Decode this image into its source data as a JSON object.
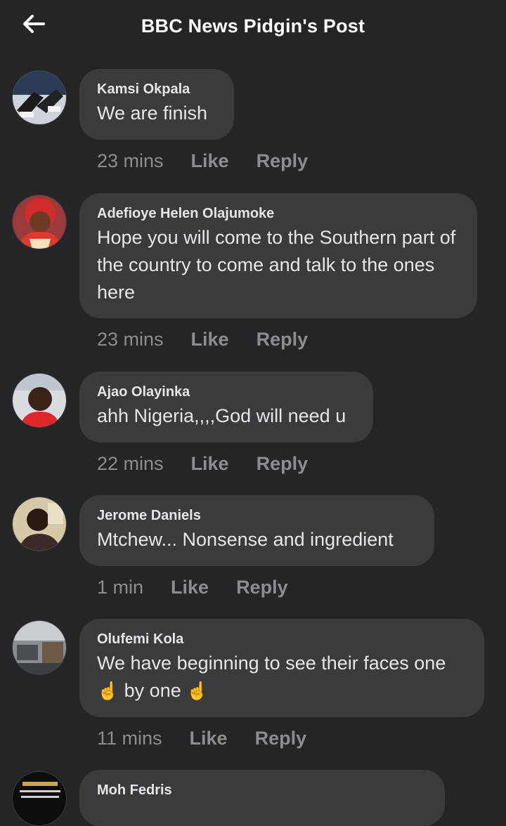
{
  "header": {
    "title": "BBC News Pidgin's Post"
  },
  "comments": [
    {
      "author": "Kamsi Okpala",
      "text": "We are finish",
      "time": "23 mins",
      "like": "Like",
      "reply": "Reply"
    },
    {
      "author": "Adefioye Helen Olajumoke",
      "text": "Hope you will come to the Southern part of the country to come and talk to the ones here",
      "time": "23 mins",
      "like": "Like",
      "reply": "Reply"
    },
    {
      "author": "Ajao Olayinka",
      "text": "ahh Nigeria,,,,God will need u",
      "time": "22 mins",
      "like": "Like",
      "reply": "Reply"
    },
    {
      "author": "Jerome Daniels",
      "text": "Mtchew... Nonsense and ingredient",
      "time": "1 min",
      "like": "Like",
      "reply": "Reply"
    },
    {
      "author": "Olufemi Kola",
      "text_part1": "We have beginning to see their faces one",
      "emoji": "☝️",
      "text_part2": "by one",
      "time": "11 mins",
      "like": "Like",
      "reply": "Reply"
    },
    {
      "author": "Moh Fedris"
    }
  ],
  "icons": {
    "back": "arrow-left-icon"
  },
  "colors": {
    "background": "#242526",
    "bubble": "#3a3b3c",
    "meta_text": "#8a8d91",
    "primary_text": "#e4e6eb"
  }
}
